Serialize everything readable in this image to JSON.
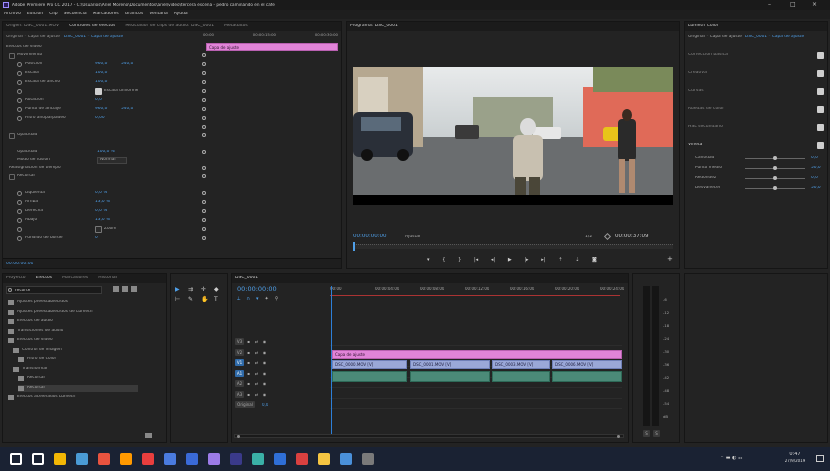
{
  "window": {
    "title": "Adobe Premiere Pro CC 2017 - C:\\Usuarios\\Ariel Moreno\\Documentos\\ariel\\video\\tercera escena - pedro caminando en el cafe",
    "controls": [
      "–",
      "□",
      "×"
    ]
  },
  "menubar": [
    "Archivo",
    "Edición",
    "Clip",
    "Secuencia",
    "Marcadores",
    "Gráficos",
    "Ventana",
    "Ayuda"
  ],
  "effect_controls": {
    "tabs": [
      "Origen: DSC_0001.MOV",
      "Controles de efectos",
      "Mezclador de clips de audio: DSC_0001",
      "Metadatos"
    ],
    "source_label": "Original * Capa de ajuste",
    "sequence_label": "DSC_0001 * Capa de ajuste",
    "timecodes": [
      "00:00",
      "00:00:15:00",
      "00:00:30:00"
    ],
    "clip_label": "Capa de ajuste",
    "section_video": "Efectos de vídeo",
    "motion": "Movimiento",
    "rows": [
      {
        "label": "Posición",
        "v1": "960,0",
        "v2": "540,0"
      },
      {
        "label": "Escala",
        "v1": "100,0",
        "v2": ""
      },
      {
        "label": "Escala de ancho",
        "v1": "100,0",
        "v2": ""
      },
      {
        "label": "",
        "v1": "Escala uniforme",
        "v2": ""
      },
      {
        "label": "Rotación",
        "v1": "0,0",
        "v2": ""
      },
      {
        "label": "Punto de anclaje",
        "v1": "960,0",
        "v2": "540,0"
      },
      {
        "label": "Filtro antiparpadeo",
        "v1": "0,00",
        "v2": ""
      }
    ],
    "opacity_section": "Opacidad",
    "opacity_value": "100,0 %",
    "blend_label": "Modo de fusión",
    "blend_value": "Normal",
    "time_remap": "Reasignación de tiempo",
    "crop_section": "Recortar",
    "crop_rows": [
      {
        "label": "Izquierda",
        "v": "0,0 %"
      },
      {
        "label": "Arriba",
        "v": "13,0 %"
      },
      {
        "label": "Derecha",
        "v": "0,0 %"
      },
      {
        "label": "Abajo",
        "v": "13,0 %"
      },
      {
        "label": "",
        "v": "Zoom"
      },
      {
        "label": "Fundido de borde",
        "v": "0"
      }
    ],
    "footer_timecode": "00:00:00:00"
  },
  "program_monitor": {
    "tab": "Programa: DSC_0001",
    "timecode": "00:00:00:00",
    "fit": "Ajustar",
    "quality": "1/2",
    "duration": "00:00:37:09"
  },
  "lumetri": {
    "title": "Lumetri Color",
    "source": "Original * Capa de ajuste",
    "sequence": "DSC_0001 * Capa de ajuste",
    "sections": [
      "Corrección básica",
      "Creativa",
      "Curvas",
      "Ruedas de color",
      "HSL secundario",
      "Viñeta"
    ],
    "sliders": [
      {
        "label": "Cantidad",
        "value": "0,0"
      },
      {
        "label": "Punto medio",
        "value": "50,0"
      },
      {
        "label": "Redondez",
        "value": "0,0"
      },
      {
        "label": "Desvanecer",
        "value": "50,0"
      }
    ]
  },
  "project_panel": {
    "tabs": [
      "Proyecto",
      "Efectos",
      "Marcadores",
      "Historial"
    ],
    "search_value": "recorte",
    "items": [
      {
        "label": "Ajustes preestablecidos",
        "indent": 0
      },
      {
        "label": "Ajustes preestablecidos de Lumetri",
        "indent": 0
      },
      {
        "label": "Efectos de audio",
        "indent": 0
      },
      {
        "label": "Transiciones de audio",
        "indent": 0
      },
      {
        "label": "Efectos de vídeo",
        "indent": 0
      },
      {
        "label": "Control de imagen",
        "indent": 1
      },
      {
        "label": "Filtro de color",
        "indent": 2
      },
      {
        "label": "Transformar",
        "indent": 1
      },
      {
        "label": "Recortar",
        "indent": 2
      },
      {
        "label": "Recortar",
        "indent": 2
      },
      {
        "label": "Efectos acelerados Lumetri",
        "indent": 0
      }
    ]
  },
  "timeline": {
    "tab": "DSC_0001",
    "timecode": "00:00:00:00",
    "ruler": [
      "00:00",
      "00:00:04:00",
      "00:00:08:00",
      "00:00:12:00",
      "00:00:16:00",
      "00:00:20:00",
      "00:00:24:00"
    ],
    "tracks": [
      {
        "name": "V3",
        "kind": "v"
      },
      {
        "name": "V2",
        "kind": "v"
      },
      {
        "name": "V1",
        "kind": "v"
      },
      {
        "name": "A1",
        "kind": "a"
      },
      {
        "name": "A2",
        "kind": "a"
      },
      {
        "name": "A3",
        "kind": "a"
      },
      {
        "name": "Original",
        "kind": "m",
        "value": "0,0"
      }
    ],
    "clips": [
      {
        "label": "Capa de ajuste",
        "kind": "pink"
      },
      {
        "label": "DSC_0000.MOV [V]",
        "kind": "video"
      },
      {
        "label": "DSC_0001.MOV [V]",
        "kind": "video"
      },
      {
        "label": "DSC_0003.MOV [V]",
        "kind": "video"
      },
      {
        "label": "DSC_0006.MOV [V]",
        "kind": "video"
      }
    ]
  },
  "audio_meter": {
    "ticks": [
      "-6",
      "-12",
      "-18",
      "-24",
      "-30",
      "-36",
      "-42",
      "-48",
      "-54",
      "dB"
    ],
    "solo": [
      "S",
      "S"
    ]
  },
  "taskbar": {
    "time": "0:47",
    "date": "27/9/2019"
  },
  "colors": {
    "accent_blue": "#4f9fe8",
    "playhead": "#2d7fd8",
    "clip_video": "#9aa8d8",
    "clip_audio": "#4b8a78",
    "clip_adjust": "#e184d8"
  }
}
